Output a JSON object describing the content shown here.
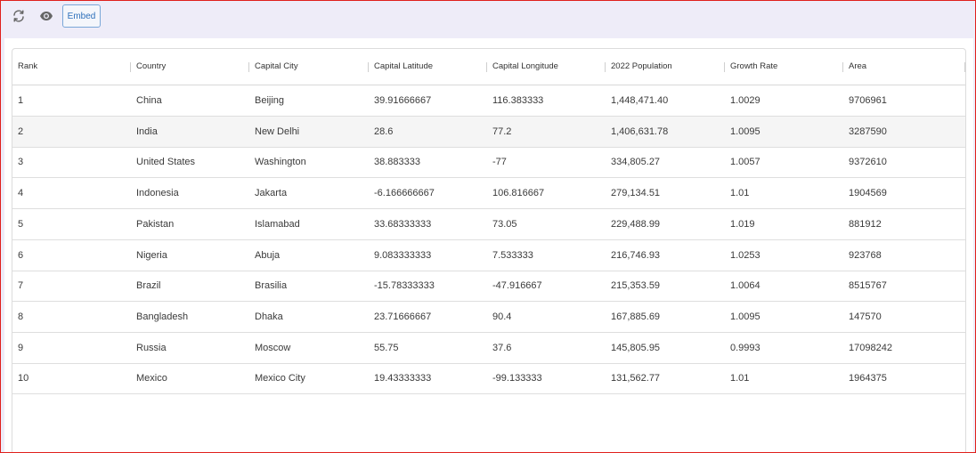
{
  "toolbar": {
    "refresh_icon": "refresh-icon",
    "view_icon": "eye-icon",
    "embed_label": "Embed"
  },
  "table": {
    "headers": [
      "Rank",
      "Country",
      "Capital City",
      "Capital Latitude",
      "Capital Longitude",
      "2022 Population",
      "Growth Rate",
      "Area"
    ],
    "rows": [
      [
        "1",
        "China",
        "Beijing",
        "39.91666667",
        "116.383333",
        "1,448,471.40",
        "1.0029",
        "9706961"
      ],
      [
        "2",
        "India",
        "New Delhi",
        "28.6",
        "77.2",
        "1,406,631.78",
        "1.0095",
        "3287590"
      ],
      [
        "3",
        "United States",
        "Washington",
        "38.883333",
        "-77",
        "334,805.27",
        "1.0057",
        "9372610"
      ],
      [
        "4",
        "Indonesia",
        "Jakarta",
        "-6.166666667",
        "106.816667",
        "279,134.51",
        "1.01",
        "1904569"
      ],
      [
        "5",
        "Pakistan",
        "Islamabad",
        "33.68333333",
        "73.05",
        "229,488.99",
        "1.019",
        "881912"
      ],
      [
        "6",
        "Nigeria",
        "Abuja",
        "9.083333333",
        "7.533333",
        "216,746.93",
        "1.0253",
        "923768"
      ],
      [
        "7",
        "Brazil",
        "Brasilia",
        "-15.78333333",
        "-47.916667",
        "215,353.59",
        "1.0064",
        "8515767"
      ],
      [
        "8",
        "Bangladesh",
        "Dhaka",
        "23.71666667",
        "90.4",
        "167,885.69",
        "1.0095",
        "147570"
      ],
      [
        "9",
        "Russia",
        "Moscow",
        "55.75",
        "37.6",
        "145,805.95",
        "0.9993",
        "17098242"
      ],
      [
        "10",
        "Mexico",
        "Mexico City",
        "19.43333333",
        "-99.133333",
        "131,562.77",
        "1.01",
        "1964375"
      ]
    ]
  },
  "colors": {
    "frame_border": "#e0201c",
    "toolbar_bg": "#eeecf8",
    "embed_accent": "#2c6fba",
    "alt_row_bg": "#f5f5f5"
  }
}
